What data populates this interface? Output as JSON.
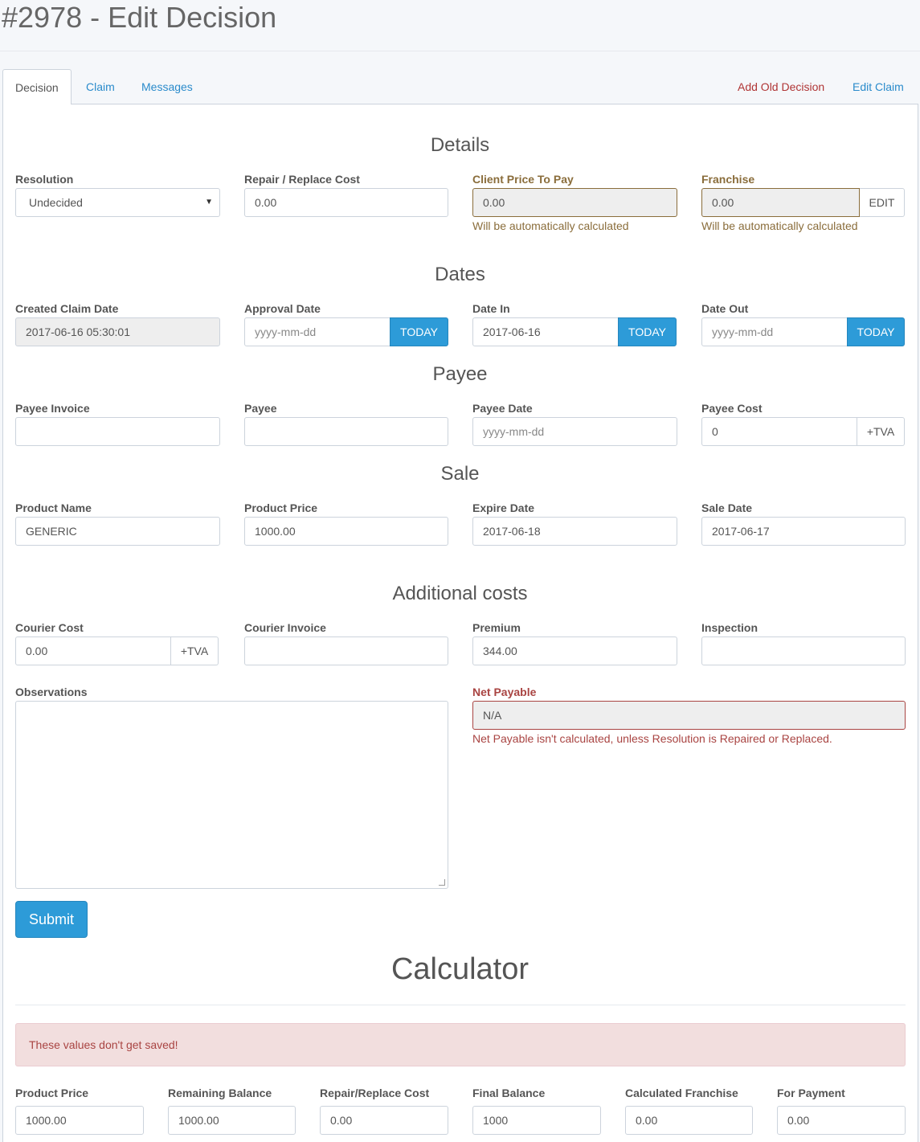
{
  "page": {
    "title": "#2978 - Edit Decision"
  },
  "tabs": {
    "decision": "Decision",
    "claim": "Claim",
    "messages": "Messages",
    "add_old_decision": "Add Old Decision",
    "edit_claim": "Edit Claim"
  },
  "details": {
    "title": "Details",
    "resolution": {
      "label": "Resolution",
      "value": "Undecided"
    },
    "repair_cost": {
      "label": "Repair / Replace Cost",
      "value": "0.00"
    },
    "client_price": {
      "label": "Client Price To Pay",
      "value": "0.00",
      "help": "Will be automatically calculated"
    },
    "franchise": {
      "label": "Franchise",
      "value": "0.00",
      "button": "EDIT",
      "help": "Will be automatically calculated"
    }
  },
  "dates": {
    "title": "Dates",
    "today_label": "TODAY",
    "created": {
      "label": "Created Claim Date",
      "value": "2017-06-16 05:30:01"
    },
    "approval": {
      "label": "Approval Date",
      "placeholder": "yyyy-mm-dd"
    },
    "date_in": {
      "label": "Date In",
      "value": "2017-06-16"
    },
    "date_out": {
      "label": "Date Out",
      "placeholder": "yyyy-mm-dd"
    }
  },
  "payee": {
    "title": "Payee",
    "invoice": {
      "label": "Payee Invoice",
      "value": ""
    },
    "payee": {
      "label": "Payee",
      "value": ""
    },
    "date": {
      "label": "Payee Date",
      "placeholder": "yyyy-mm-dd"
    },
    "cost": {
      "label": "Payee Cost",
      "value": "0",
      "addon": "+TVA"
    }
  },
  "sale": {
    "title": "Sale",
    "product_name": {
      "label": "Product Name",
      "value": "GENERIC"
    },
    "product_price": {
      "label": "Product Price",
      "value": "1000.00"
    },
    "expire_date": {
      "label": "Expire Date",
      "value": "2017-06-18"
    },
    "sale_date": {
      "label": "Sale Date",
      "value": "2017-06-17"
    }
  },
  "additional": {
    "title": "Additional costs",
    "courier_cost": {
      "label": "Courier Cost",
      "value": "0.00",
      "addon": "+TVA"
    },
    "courier_invoice": {
      "label": "Courier Invoice",
      "value": ""
    },
    "premium": {
      "label": "Premium",
      "value": "344.00"
    },
    "inspection": {
      "label": "Inspection",
      "value": ""
    },
    "observations": {
      "label": "Observations",
      "value": ""
    },
    "net_payable": {
      "label": "Net Payable",
      "value": "N/A",
      "help": "Net Payable isn't calculated, unless Resolution is Repaired or Replaced."
    }
  },
  "submit_label": "Submit",
  "calculator": {
    "title": "Calculator",
    "alert": "These values don't get saved!",
    "fields": [
      {
        "label": "Product Price",
        "value": "1000.00"
      },
      {
        "label": "Remaining Balance",
        "value": "1000.00"
      },
      {
        "label": "Repair/Replace Cost",
        "value": "0.00"
      },
      {
        "label": "Final Balance",
        "value": "1000"
      },
      {
        "label": "Calculated Franchise",
        "value": "0.00"
      },
      {
        "label": "For Payment",
        "value": "0.00"
      }
    ]
  },
  "colors": {
    "primary": "#2d9bd8",
    "link": "#2a8bcb",
    "danger": "#a94442",
    "warning": "#8a6d3b"
  }
}
